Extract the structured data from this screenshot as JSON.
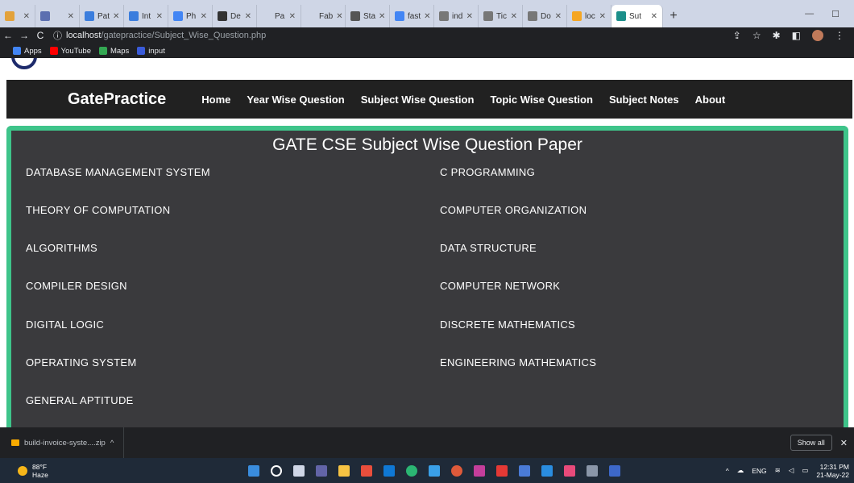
{
  "browser": {
    "tabs": [
      {
        "label": "",
        "color": "#e3a23b"
      },
      {
        "label": "",
        "color": "#5c6fb0"
      },
      {
        "label": "Pat",
        "color": "#3b7ddd"
      },
      {
        "label": "Int",
        "color": "#3b7ddd"
      },
      {
        "label": "Ph",
        "color": "#4285f4"
      },
      {
        "label": "De",
        "color": "#333333"
      },
      {
        "label": "Pa",
        "color": "#cfd6e6"
      },
      {
        "label": "Fab",
        "color": "#cfd6e6"
      },
      {
        "label": "Sta",
        "color": "#555555"
      },
      {
        "label": "fast",
        "color": "#4285f4"
      },
      {
        "label": "ind",
        "color": "#777777"
      },
      {
        "label": "Tic",
        "color": "#777777"
      },
      {
        "label": "Do",
        "color": "#777777"
      },
      {
        "label": "loc",
        "color": "#f5a623"
      },
      {
        "label": "Sut",
        "color": "#1b8f8a",
        "active": true
      }
    ],
    "url_host": "localhost",
    "url_path": "/gatepractice/Subject_Wise_Question.php",
    "bookmarks": [
      {
        "label": "Apps",
        "color": "#4285f4"
      },
      {
        "label": "YouTube",
        "color": "#ff0000"
      },
      {
        "label": "Maps",
        "color": "#34a853"
      },
      {
        "label": "input",
        "color": "#3a5bd9"
      }
    ]
  },
  "site": {
    "brand": "GatePractice",
    "nav": [
      "Home",
      "Year Wise Question",
      "Subject Wise Question",
      "Topic Wise Question",
      "Subject Notes",
      "About"
    ],
    "title": "GATE CSE Subject Wise Question Paper",
    "left_subjects": [
      "DATABASE MANAGEMENT SYSTEM",
      "THEORY OF COMPUTATION",
      "ALGORITHMS",
      "COMPILER DESIGN",
      "DIGITAL LOGIC",
      "OPERATING SYSTEM",
      "GENERAL APTITUDE"
    ],
    "right_subjects": [
      "C PROGRAMMING",
      "COMPUTER ORGANIZATION",
      "DATA STRUCTURE",
      "COMPUTER NETWORK",
      "DISCRETE MATHEMATICS",
      "ENGINEERING MATHEMATICS"
    ],
    "colors": {
      "navbar": "#212121",
      "card_bg": "#3a3a3d",
      "card_border": "#3ec48a"
    }
  },
  "downloads": {
    "file": "build-invoice-syste....zip",
    "show_all": "Show all"
  },
  "taskbar": {
    "temp": "88°F",
    "condition": "Haze",
    "lang": "ENG",
    "time": "12:31 PM",
    "date": "21-May-22"
  }
}
